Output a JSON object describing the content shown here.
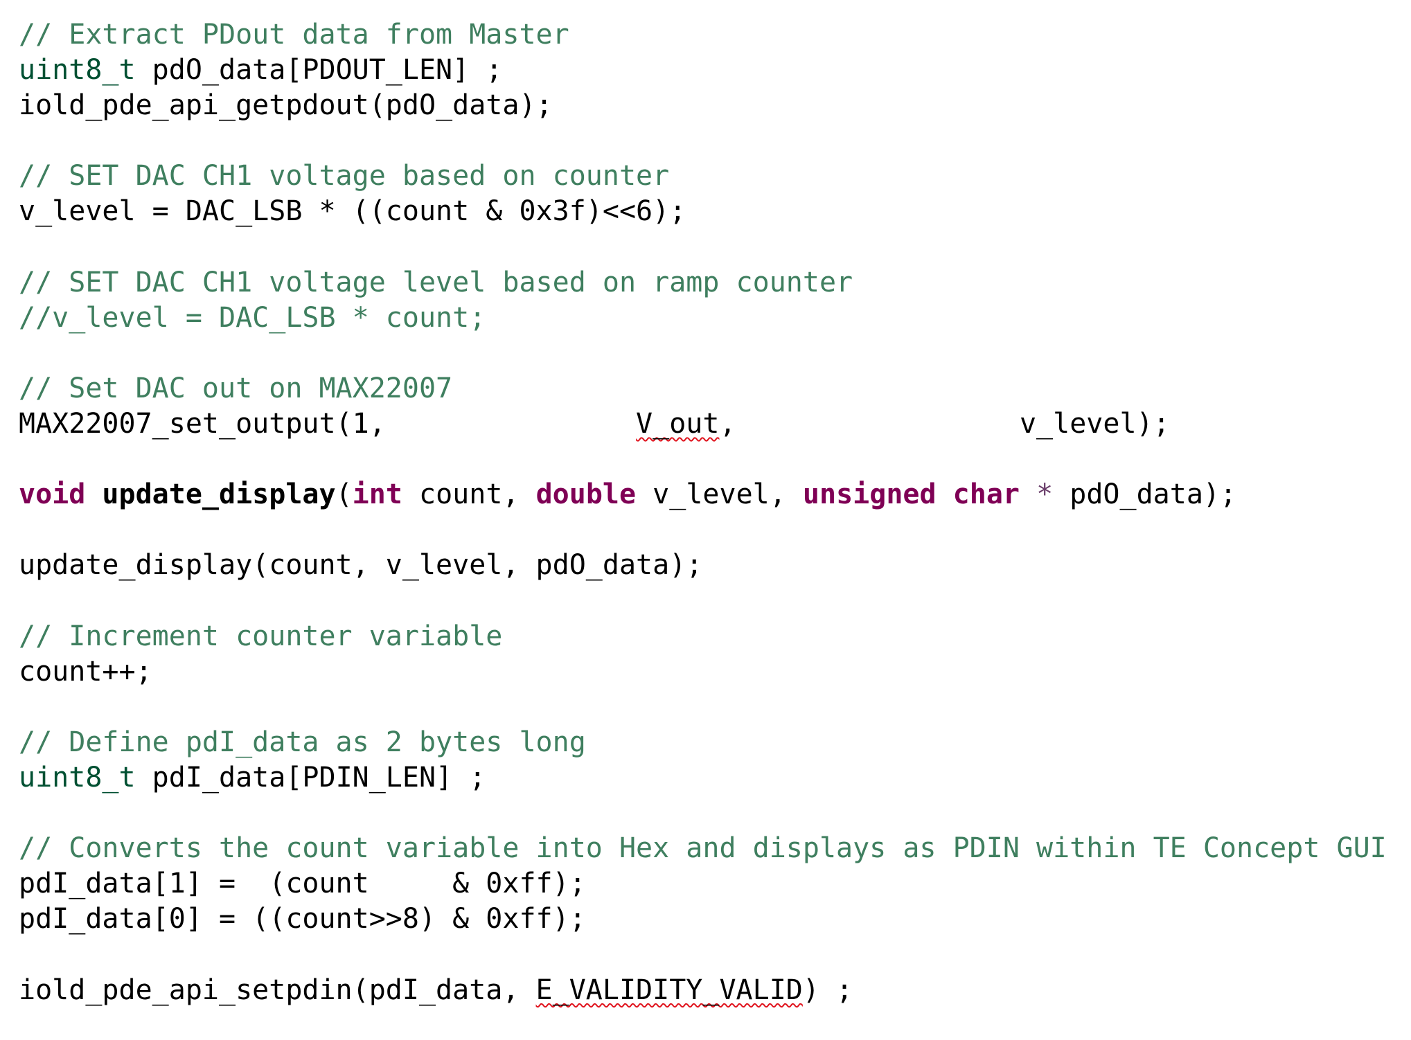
{
  "colors": {
    "background": "#ffffff",
    "comment": "#3f7f5f",
    "typedef": "#005032",
    "keyword": "#7f0055",
    "text": "#000000",
    "spellcheck_underline": "#e0141e"
  },
  "code": {
    "lines": [
      [
        {
          "t": "comment",
          "s": "// Extract PDout data from Master"
        }
      ],
      [
        {
          "t": "type",
          "s": "uint8_t"
        },
        {
          "t": "plain",
          "s": " pdO_data[PDOUT_LEN] ;"
        }
      ],
      [
        {
          "t": "plain",
          "s": "iold_pde_api_getpdout(pdO_data);"
        }
      ],
      [],
      [
        {
          "t": "comment",
          "s": "// SET DAC CH1 voltage based on counter"
        }
      ],
      [
        {
          "t": "plain",
          "s": "v_level = DAC_LSB * ((count & 0x3f)<<6);"
        }
      ],
      [],
      [
        {
          "t": "comment",
          "s": "// SET DAC CH1 voltage level based on ramp counter"
        }
      ],
      [
        {
          "t": "comment",
          "s": "//v_level = DAC_LSB * count;"
        }
      ],
      [],
      [
        {
          "t": "comment",
          "s": "// Set DAC out on MAX22007"
        }
      ],
      [
        {
          "t": "plain",
          "s": "MAX22007_set_output(1,               "
        },
        {
          "t": "squiggle",
          "s": "V_out"
        },
        {
          "t": "plain",
          "s": ",                 v_level);"
        }
      ],
      [],
      [
        {
          "t": "keyword",
          "s": "void"
        },
        {
          "t": "plain",
          "s": " "
        },
        {
          "t": "func-decl",
          "s": "update_display"
        },
        {
          "t": "plain",
          "s": "("
        },
        {
          "t": "keyword",
          "s": "int"
        },
        {
          "t": "plain",
          "s": " count, "
        },
        {
          "t": "keyword",
          "s": "double"
        },
        {
          "t": "plain",
          "s": " v_level, "
        },
        {
          "t": "keyword",
          "s": "unsigned"
        },
        {
          "t": "plain",
          "s": " "
        },
        {
          "t": "keyword",
          "s": "char"
        },
        {
          "t": "plain",
          "s": " "
        },
        {
          "t": "op",
          "s": "*"
        },
        {
          "t": "plain",
          "s": " pdO_data);"
        }
      ],
      [],
      [
        {
          "t": "plain",
          "s": "update_display(count, v_level, pdO_data);"
        }
      ],
      [],
      [
        {
          "t": "comment",
          "s": "// Increment counter variable"
        }
      ],
      [
        {
          "t": "plain",
          "s": "count++;"
        }
      ],
      [],
      [
        {
          "t": "comment",
          "s": "// Define pdI_data as 2 bytes long"
        }
      ],
      [
        {
          "t": "type",
          "s": "uint8_t"
        },
        {
          "t": "plain",
          "s": " pdI_data[PDIN_LEN] ;"
        }
      ],
      [],
      [
        {
          "t": "comment",
          "s": "// Converts the count variable into Hex and displays as PDIN within TE Concept GUI"
        }
      ],
      [
        {
          "t": "plain",
          "s": "pdI_data[1] =  (count     & 0xff);"
        }
      ],
      [
        {
          "t": "plain",
          "s": "pdI_data[0] = ((count>>8) & 0xff);"
        }
      ],
      [],
      [
        {
          "t": "plain",
          "s": "iold_pde_api_setpdin(pdI_data, "
        },
        {
          "t": "squiggle",
          "s": "E_VALIDITY_VALID"
        },
        {
          "t": "plain",
          "s": ") ;"
        }
      ]
    ]
  }
}
